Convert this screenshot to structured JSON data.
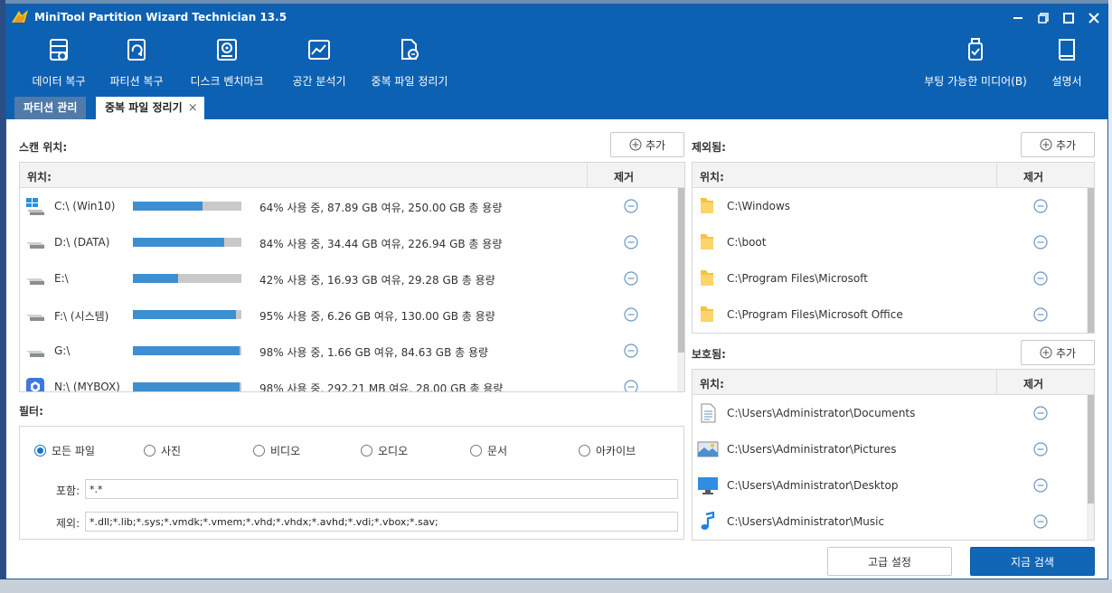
{
  "window": {
    "title": "MiniTool Partition Wizard Technician 13.5"
  },
  "toolbar": {
    "left": [
      {
        "label": "데이터 복구",
        "icon": "data-recovery-icon"
      },
      {
        "label": "파티션 복구",
        "icon": "partition-recovery-icon"
      },
      {
        "label": "디스크 벤치마크",
        "icon": "disk-benchmark-icon"
      },
      {
        "label": "공간 분석기",
        "icon": "space-analyzer-icon"
      },
      {
        "label": "중복 파일 정리기",
        "icon": "duplicate-file-icon"
      }
    ],
    "right": [
      {
        "label": "부팅 가능한 미디어(B)",
        "icon": "bootable-media-icon"
      },
      {
        "label": "설명서",
        "icon": "manual-icon"
      }
    ]
  },
  "tabs": [
    {
      "label": "파티션 관리",
      "active": false
    },
    {
      "label": "중복 파일 정리기",
      "active": true
    }
  ],
  "scan": {
    "title": "스캔 위치:",
    "add_label": "추가",
    "col_location": "위치:",
    "col_remove": "제거",
    "rows": [
      {
        "name": "C:\\ (Win10)",
        "used": 0.64,
        "usage": "64% 사용 중, 87.89 GB 여유, 250.00 GB 총 용량",
        "icon": "windows-drive-icon"
      },
      {
        "name": "D:\\ (DATA)",
        "used": 0.84,
        "usage": "84% 사용 중, 34.44 GB 여유, 226.94 GB 총 용량",
        "icon": "drive-icon"
      },
      {
        "name": "E:\\",
        "used": 0.42,
        "usage": "42% 사용 중, 16.93 GB 여유, 29.28 GB 총 용량",
        "icon": "drive-icon"
      },
      {
        "name": "F:\\ (시스템)",
        "used": 0.95,
        "usage": "95% 사용 중, 6.26 GB 여유, 130.00 GB 총 용량",
        "icon": "drive-icon"
      },
      {
        "name": "G:\\",
        "used": 0.98,
        "usage": "98% 사용 중, 1.66 GB 여유, 84.63 GB 총 용량",
        "icon": "drive-icon"
      },
      {
        "name": "N:\\ (MYBOX)",
        "used": 0.98,
        "usage": "98% 사용 중, 292.21 MB 여유, 28.00 GB 총 용량",
        "icon": "mybox-drive-icon"
      }
    ]
  },
  "excluded": {
    "title": "제외됨:",
    "add_label": "추가",
    "col_location": "위치:",
    "col_remove": "제거",
    "rows": [
      {
        "path": "C:\\Windows"
      },
      {
        "path": "C:\\boot"
      },
      {
        "path": "C:\\Program Files\\Microsoft"
      },
      {
        "path": "C:\\Program Files\\Microsoft Office"
      }
    ]
  },
  "protected": {
    "title": "보호됨:",
    "add_label": "추가",
    "col_location": "위치:",
    "col_remove": "제거",
    "rows": [
      {
        "path": "C:\\Users\\Administrator\\Documents",
        "icon": "documents-icon"
      },
      {
        "path": "C:\\Users\\Administrator\\Pictures",
        "icon": "pictures-icon"
      },
      {
        "path": "C:\\Users\\Administrator\\Desktop",
        "icon": "desktop-icon"
      },
      {
        "path": "C:\\Users\\Administrator\\Music",
        "icon": "music-icon"
      }
    ]
  },
  "filter": {
    "title": "필터:",
    "options": [
      {
        "label": "모든 파일",
        "selected": true
      },
      {
        "label": "사진",
        "selected": false
      },
      {
        "label": "비디오",
        "selected": false
      },
      {
        "label": "오디오",
        "selected": false
      },
      {
        "label": "문서",
        "selected": false
      },
      {
        "label": "아카이브",
        "selected": false
      }
    ],
    "include_label": "포함:",
    "include_value": "*.*",
    "exclude_label": "제외:",
    "exclude_value": "*.dll;*.lib;*.sys;*.vmdk;*.vmem;*.vhd;*.vhdx;*.avhd;*.vdi;*.vbox;*.sav;"
  },
  "actions": {
    "advanced": "고급 설정",
    "scan_now": "지금 검색"
  },
  "colors": {
    "header": "#0d61b3",
    "bar_fill": "#3d8fd1",
    "bar_track": "#c9c9c9",
    "primary_button": "#1166b5"
  }
}
